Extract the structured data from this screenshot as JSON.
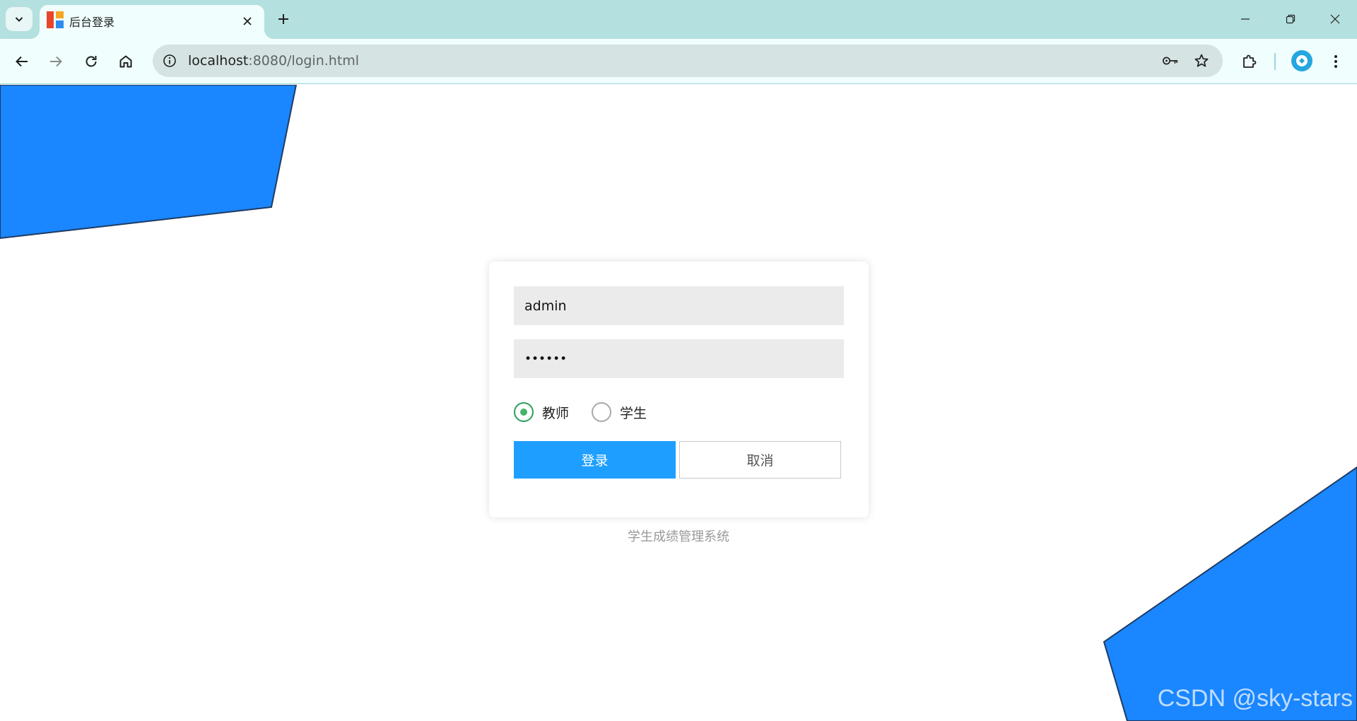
{
  "browser": {
    "tab_title": "后台登录",
    "url_host": "localhost",
    "url_rest": ":8080/login.html"
  },
  "icons": {
    "tab_search": "chevron-down-icon",
    "tab_close": "close-icon",
    "new_tab": "plus-icon",
    "minimize": "minimize-icon",
    "restore": "restore-icon",
    "close_window": "close-icon",
    "back": "arrow-left-icon",
    "forward": "arrow-right-icon",
    "reload": "reload-icon",
    "home": "home-icon",
    "site_info": "info-icon",
    "password": "key-icon",
    "bookmark": "star-icon",
    "extensions": "puzzle-icon",
    "menu": "kebab-menu-icon"
  },
  "colors": {
    "decor_blue": "#1a86ff",
    "primary_button": "#1e9fff",
    "radio_checked": "#46b36b",
    "tab_strip": "#b4e0df"
  },
  "login": {
    "username_value": "admin",
    "password_value": "••••••",
    "roles": [
      {
        "label": "教师",
        "checked": true
      },
      {
        "label": "学生",
        "checked": false
      }
    ],
    "login_button": "登录",
    "cancel_button": "取消"
  },
  "footer": {
    "system_name": "学生成绩管理系统"
  },
  "watermark": "CSDN @sky-stars"
}
